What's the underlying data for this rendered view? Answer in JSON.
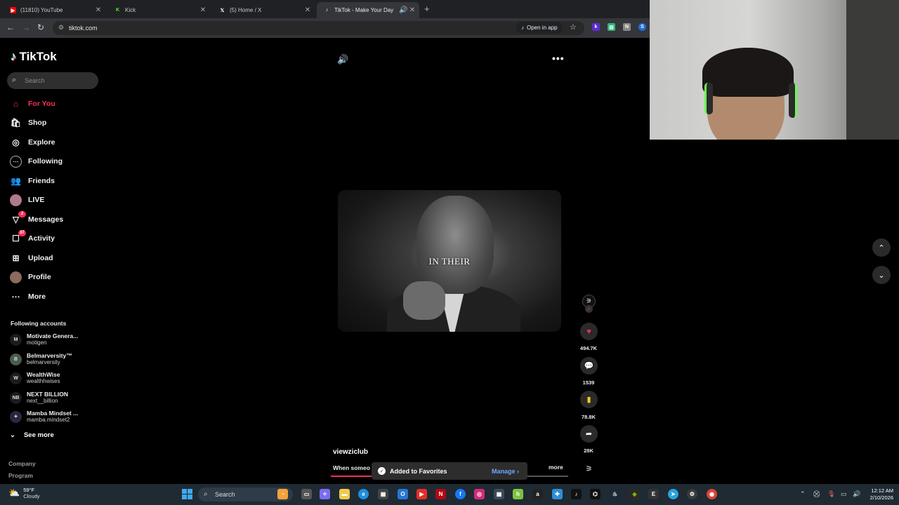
{
  "browser": {
    "tabs": [
      {
        "title": "(11810) YouTube",
        "icon": "youtube-icon",
        "color": "#ff0000",
        "active": false
      },
      {
        "title": "Kick",
        "icon": "kick-icon",
        "color": "#53fc18",
        "active": false
      },
      {
        "title": "(5) Home / X",
        "icon": "x-icon",
        "color": "#ffffff",
        "active": false
      },
      {
        "title": "TikTok - Make Your Day",
        "icon": "tiktok-icon",
        "color": "#ffffff",
        "active": true
      }
    ],
    "url": "tiktok.com",
    "open_in_app": "Open in app"
  },
  "tiktok": {
    "logo": "TikTok",
    "search_placeholder": "Search",
    "accent": "#fe2c55",
    "nav": [
      {
        "label": "For You",
        "icon": "home-icon",
        "active": true
      },
      {
        "label": "Shop",
        "icon": "shop-icon",
        "active": false
      },
      {
        "label": "Explore",
        "icon": "compass-icon",
        "active": false
      },
      {
        "label": "Following",
        "icon": "following-icon",
        "active": false
      },
      {
        "label": "Friends",
        "icon": "friends-icon",
        "active": false
      },
      {
        "label": "LIVE",
        "icon": "live-icon",
        "active": false
      },
      {
        "label": "Messages",
        "icon": "messages-icon",
        "active": false,
        "badge": "2"
      },
      {
        "label": "Activity",
        "icon": "activity-icon",
        "active": false,
        "badge": "37"
      },
      {
        "label": "Upload",
        "icon": "upload-icon",
        "active": false
      },
      {
        "label": "Profile",
        "icon": "profile-icon",
        "active": false
      },
      {
        "label": "More",
        "icon": "more-icon",
        "active": false
      }
    ],
    "following_title": "Following accounts",
    "following": [
      {
        "name": "Motivate Genera...",
        "handle": "motigen"
      },
      {
        "name": "Belmarversity™",
        "handle": "belmarversity"
      },
      {
        "name": "WealthWise",
        "handle": "wealthhwises"
      },
      {
        "name": "NEXT BILLION",
        "handle": "next__billion"
      },
      {
        "name": "Mamba Mindset ...",
        "handle": "mamba.mindset2"
      }
    ],
    "see_more": "See more",
    "footer": [
      "Company",
      "Program"
    ],
    "video": {
      "caption": "IN THEIR",
      "username": "viewziclub",
      "description": "When someo",
      "more": "more",
      "progress": 0.18
    },
    "actions": {
      "likes": "494.7K",
      "comments": "1539",
      "saves": "78.8K",
      "shares": "28K"
    },
    "toast": {
      "text": "Added to Favorites",
      "action": "Manage"
    }
  },
  "taskbar": {
    "weather_temp": "59°F",
    "weather_desc": "Cloudy",
    "search": "Search",
    "time": "12:12 AM",
    "date": "2/10/2026"
  }
}
